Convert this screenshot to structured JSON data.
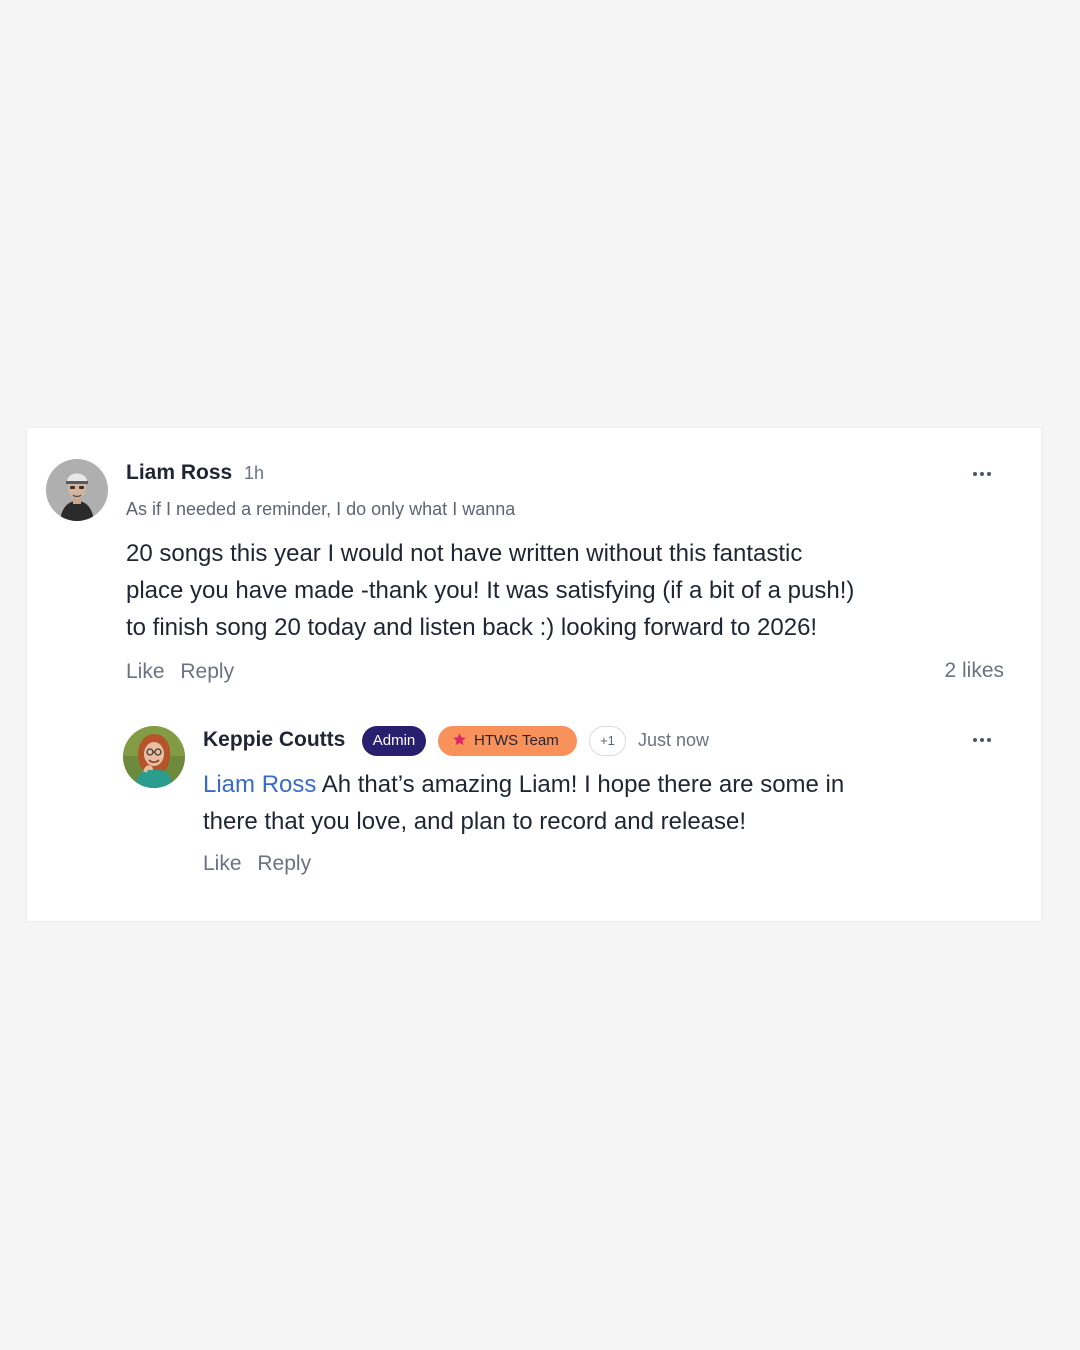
{
  "comment": {
    "author": "Liam Ross",
    "time": "1h",
    "subtitle": "As if I needed a reminder, I do only what I wanna",
    "body_lines": [
      "20 songs this year I would not have written without this fantastic",
      "place you have made -thank you! It was satisfying (if a bit of a push!)",
      "to finish song 20 today and listen back :) looking forward to 2026!"
    ],
    "like_label": "Like",
    "reply_label": "Reply",
    "likes_count": "2 likes",
    "more_icon": "ellipsis-icon"
  },
  "reply": {
    "author": "Keppie Coutts",
    "badges": {
      "admin": "Admin",
      "team": "HTWS Team",
      "team_icon": "star-icon",
      "extra": "+1"
    },
    "time": "Just now",
    "mention": "Liam Ross",
    "body_line1": " Ah that’s amazing Liam! I hope there are some in",
    "body_line2": "there that you love, and plan to record and release!",
    "like_label": "Like",
    "reply_label": "Reply",
    "more_icon": "ellipsis-icon"
  },
  "colors": {
    "background": "#f5f5f5",
    "card": "#ffffff",
    "admin_badge": "#2a1f6e",
    "team_badge": "#f9915a",
    "team_star": "#e0246a",
    "mention": "#3b6cc4"
  }
}
